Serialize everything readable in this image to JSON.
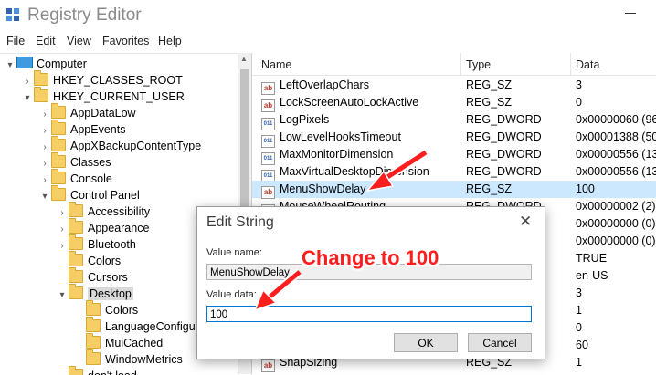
{
  "window": {
    "title": "Registry Editor"
  },
  "menu": [
    "File",
    "Edit",
    "View",
    "Favorites",
    "Help"
  ],
  "tree": [
    {
      "label": "Computer",
      "indent": 0,
      "arrow": "▾",
      "icon": "computer"
    },
    {
      "label": "HKEY_CLASSES_ROOT",
      "indent": 1,
      "arrow": "›",
      "icon": "folder"
    },
    {
      "label": "HKEY_CURRENT_USER",
      "indent": 1,
      "arrow": "▾",
      "icon": "folder"
    },
    {
      "label": "AppDataLow",
      "indent": 2,
      "arrow": "›",
      "icon": "folder"
    },
    {
      "label": "AppEvents",
      "indent": 2,
      "arrow": "›",
      "icon": "folder"
    },
    {
      "label": "AppXBackupContentType",
      "indent": 2,
      "arrow": "›",
      "icon": "folder"
    },
    {
      "label": "Classes",
      "indent": 2,
      "arrow": "›",
      "icon": "folder"
    },
    {
      "label": "Console",
      "indent": 2,
      "arrow": "›",
      "icon": "folder"
    },
    {
      "label": "Control Panel",
      "indent": 2,
      "arrow": "▾",
      "icon": "folder"
    },
    {
      "label": "Accessibility",
      "indent": 3,
      "arrow": "›",
      "icon": "folder"
    },
    {
      "label": "Appearance",
      "indent": 3,
      "arrow": "›",
      "icon": "folder"
    },
    {
      "label": "Bluetooth",
      "indent": 3,
      "arrow": "›",
      "icon": "folder"
    },
    {
      "label": "Colors",
      "indent": 3,
      "arrow": "",
      "icon": "folder"
    },
    {
      "label": "Cursors",
      "indent": 3,
      "arrow": "",
      "icon": "folder"
    },
    {
      "label": "Desktop",
      "indent": 3,
      "arrow": "▾",
      "icon": "folder",
      "selected": true
    },
    {
      "label": "Colors",
      "indent": 4,
      "arrow": "",
      "icon": "folder"
    },
    {
      "label": "LanguageConfigu",
      "indent": 4,
      "arrow": "",
      "icon": "folder"
    },
    {
      "label": "MuiCached",
      "indent": 4,
      "arrow": "",
      "icon": "folder"
    },
    {
      "label": "WindowMetrics",
      "indent": 4,
      "arrow": "",
      "icon": "folder"
    },
    {
      "label": "don't load",
      "indent": 3,
      "arrow": "",
      "icon": "folder"
    }
  ],
  "list": {
    "columns": [
      "Name",
      "Type",
      "Data"
    ],
    "rows": [
      {
        "name": "LeftOverlapChars",
        "type": "REG_SZ",
        "data": "3",
        "icon": "sz"
      },
      {
        "name": "LockScreenAutoLockActive",
        "type": "REG_SZ",
        "data": "0",
        "icon": "sz"
      },
      {
        "name": "LogPixels",
        "type": "REG_DWORD",
        "data": "0x00000060 (96)",
        "icon": "dword"
      },
      {
        "name": "LowLevelHooksTimeout",
        "type": "REG_DWORD",
        "data": "0x00001388 (5000",
        "icon": "dword"
      },
      {
        "name": "MaxMonitorDimension",
        "type": "REG_DWORD",
        "data": "0x00000556 (1366",
        "icon": "dword"
      },
      {
        "name": "MaxVirtualDesktopDimension",
        "type": "REG_DWORD",
        "data": "0x00000556 (1366",
        "icon": "dword"
      },
      {
        "name": "MenuShowDelay",
        "type": "REG_SZ",
        "data": "100",
        "icon": "sz",
        "selected": true
      },
      {
        "name": "MouseWheelRouting",
        "type": "REG_DWORD",
        "data": "0x00000002 (2)",
        "icon": "dword"
      },
      {
        "name": "",
        "type": "",
        "data": "0x00000000 (0)",
        "icon": ""
      },
      {
        "name": "",
        "type": "",
        "data": "0x00000000 (0)",
        "icon": ""
      },
      {
        "name": "",
        "type": "",
        "data": "TRUE",
        "icon": ""
      },
      {
        "name": "",
        "type": "",
        "data": "en-US",
        "icon": ""
      },
      {
        "name": "",
        "type": "",
        "data": "3",
        "icon": ""
      },
      {
        "name": "",
        "type": "",
        "data": "1",
        "icon": ""
      },
      {
        "name": "",
        "type": "",
        "data": "0",
        "icon": ""
      },
      {
        "name": "",
        "type": "",
        "data": "60",
        "icon": ""
      },
      {
        "name": "SnapSizing",
        "type": "REG_SZ",
        "data": "1",
        "icon": "sz"
      }
    ]
  },
  "dialog": {
    "title": "Edit String",
    "close": "✕",
    "value_name_label": "Value name:",
    "value_name": "MenuShowDelay",
    "value_data_label": "Value data:",
    "value_data": "100",
    "ok": "OK",
    "cancel": "Cancel"
  },
  "annotation": {
    "text": "Change to 100",
    "color": "#ff1e1e"
  }
}
